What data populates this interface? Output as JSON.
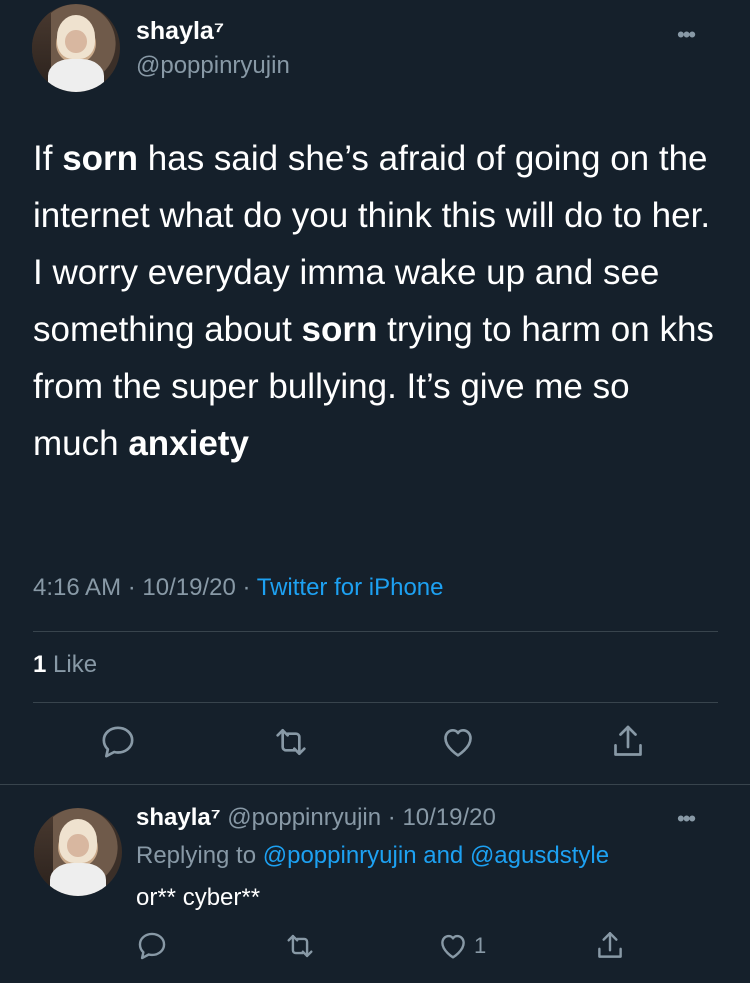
{
  "tweet": {
    "display_name": "shayla⁷",
    "handle": "@poppinryujin",
    "text_segments": [
      {
        "text": "If ",
        "bold": false
      },
      {
        "text": "sorn",
        "bold": true
      },
      {
        "text": " has said she’s afraid of going on the internet what do you think this will do to her. I worry everyday imma wake up and see something about ",
        "bold": false
      },
      {
        "text": "sorn",
        "bold": true
      },
      {
        "text": " trying to harm on khs from the super bullying. It’s give me so much ",
        "bold": false
      },
      {
        "text": "anxiety",
        "bold": true
      }
    ],
    "time": "4:16 AM",
    "separator": "·",
    "date": "10/19/20",
    "source": "Twitter for iPhone",
    "like_count": "1",
    "like_label": "Like"
  },
  "reply": {
    "display_name": "shayla⁷",
    "handle": "@poppinryujin",
    "separator": "·",
    "date": "10/19/20",
    "replying_prefix": "Replying to",
    "mention_1": "@poppinryujin",
    "conjunction": "and",
    "mention_2": "@agusdstyle",
    "text": "or** cyber**",
    "like_count": "1"
  },
  "icons": {
    "more": "more-horizontal-icon",
    "reply": "reply-icon",
    "retweet": "retweet-icon",
    "like": "heart-icon",
    "share": "share-icon"
  },
  "colors": {
    "background": "#15202b",
    "text": "#ffffff",
    "muted": "#8899a6",
    "accent": "#1da1f2",
    "divider": "#38444d"
  }
}
